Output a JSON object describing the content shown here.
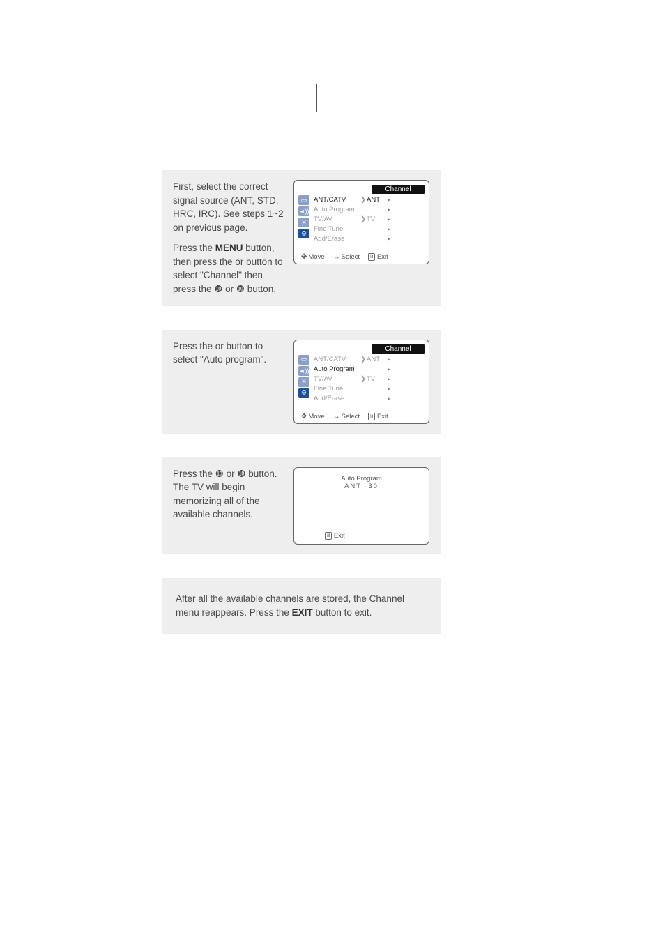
{
  "step1": {
    "para1_pre": "First, select the correct signal source (ANT, STD, HRC, IRC). See steps 1~2 on previous page.",
    "para2_a": "Press the ",
    "para2_menu": "MENU",
    "para2_b": " button, then press the     or     button to select \"Channel\" then press the ❿ or ❿ but­ton."
  },
  "step2": {
    "text": "Press the     or     button to select \"Auto program\"."
  },
  "step3": {
    "text": "Press the ❿ or ❿ button. The TV will begin memorizing all of the available channels."
  },
  "step4": {
    "a": "After all the available channels are stored, the Channel menu reappears. Press the ",
    "exit": "EXIT",
    "b": " button to exit."
  },
  "osd": {
    "title": "Channel",
    "items": {
      "ant": "ANT/CATV",
      "auto": "Auto Program",
      "tvav": "TV/AV",
      "fine": "Fine Tune",
      "add": "Add/Erase"
    },
    "vals": {
      "ant": "ANT",
      "tv": "TV"
    },
    "footer": {
      "move": "Move",
      "select": "Select",
      "exit": "Exit"
    }
  },
  "autoOsd": {
    "title": "Auto Program",
    "sub_a": "ANT",
    "sub_b": "30",
    "exit": "Exit"
  },
  "glyph": {
    "chevR": "❯",
    "tri": "▸",
    "updown": "✥",
    "leftright": "↔",
    "iii": "III"
  }
}
